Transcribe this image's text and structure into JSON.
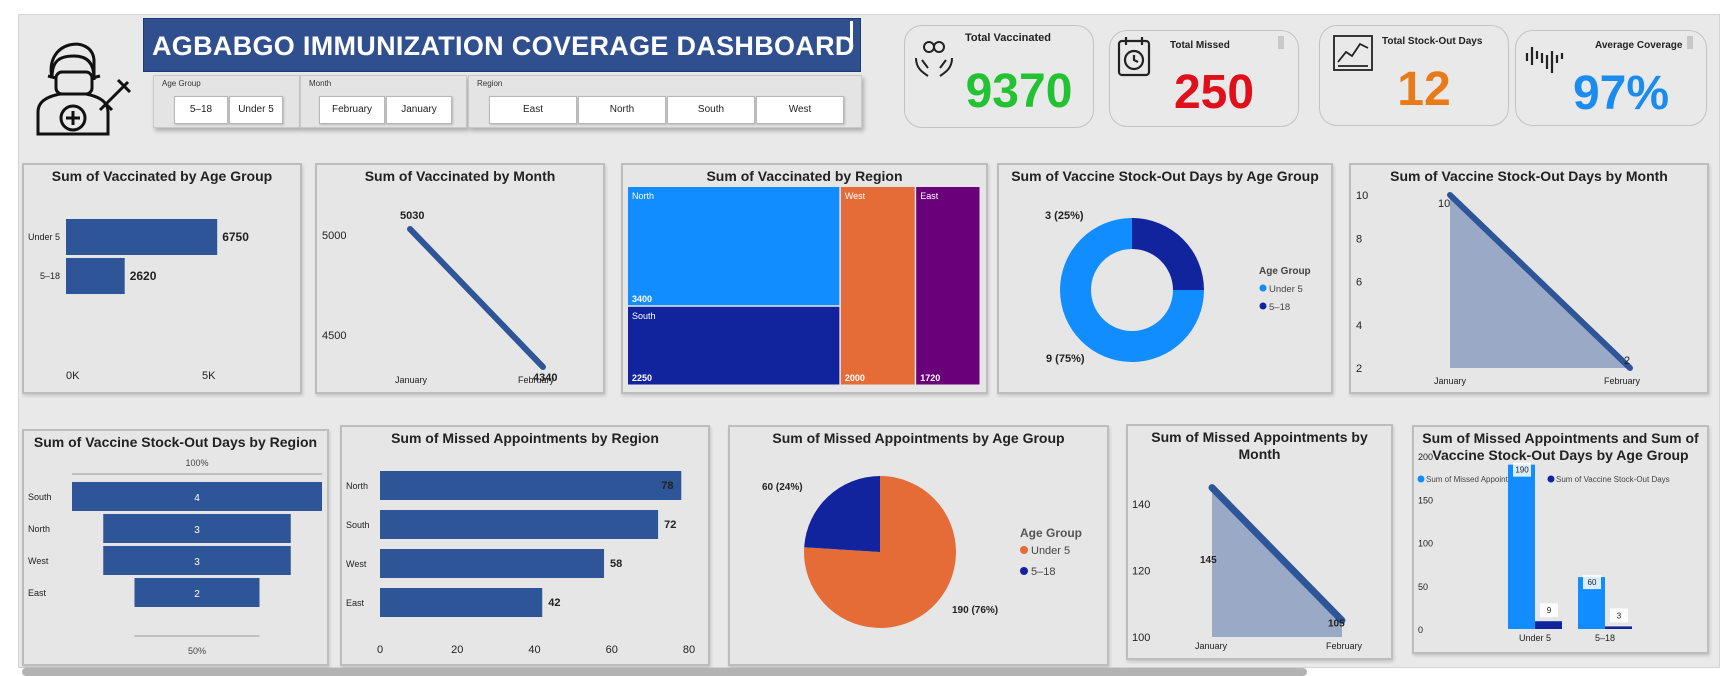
{
  "header": {
    "title": "AGBABGO IMMUNIZATION COVERAGE DASHBOARD"
  },
  "slicers": {
    "age_group": {
      "label": "Age Group",
      "options": [
        "5–18",
        "Under 5"
      ]
    },
    "month": {
      "label": "Month",
      "options": [
        "February",
        "January"
      ]
    },
    "region": {
      "label": "Region",
      "options": [
        "East",
        "North",
        "South",
        "West"
      ]
    }
  },
  "kpis": {
    "vaccinated": {
      "label": "Total Vaccinated",
      "value": "9370",
      "color": "#22c232"
    },
    "missed": {
      "label": "Total Missed",
      "value": "250",
      "color": "#e0101a"
    },
    "stockout": {
      "label": "Total Stock-Out Days",
      "value": "12",
      "color": "#e87a17"
    },
    "coverage": {
      "label": "Average Coverage",
      "value": "97%",
      "color": "#1a8cf0"
    }
  },
  "colors": {
    "bar": "#2e5597",
    "light_blue": "#118dff",
    "dark_blue": "#12239e",
    "orange": "#e66c37",
    "purple": "#6b007b",
    "area": "#9aa9c6"
  },
  "chart_data": [
    {
      "id": "vacc_age",
      "type": "bar",
      "title": "Sum of Vaccinated by Age Group",
      "categories": [
        "Under 5",
        "5–18"
      ],
      "values": [
        6750,
        2620
      ],
      "ticks": [
        "0K",
        "5K"
      ],
      "xlim": [
        0,
        7500
      ]
    },
    {
      "id": "vacc_month",
      "type": "line",
      "title": "Sum of Vaccinated by Month",
      "categories": [
        "January",
        "February"
      ],
      "values": [
        5030,
        4340
      ],
      "yticks": [
        "5000",
        "4500"
      ],
      "ylim": [
        4250,
        5200
      ]
    },
    {
      "id": "vacc_region",
      "type": "treemap",
      "title": "Sum of Vaccinated by Region",
      "categories": [
        "North",
        "South",
        "West",
        "East"
      ],
      "values": [
        3400,
        2250,
        2000,
        1720
      ]
    },
    {
      "id": "stock_age",
      "type": "donut",
      "title": "Sum of Vaccine Stock-Out Days by Age Group",
      "legend_title": "Age Group",
      "categories": [
        "Under 5",
        "5–18"
      ],
      "values": [
        9,
        3
      ],
      "labels": [
        "9 (75%)",
        "3 (25%)"
      ]
    },
    {
      "id": "stock_month",
      "type": "area",
      "title": "Sum of Vaccine Stock-Out Days by Month",
      "categories": [
        "January",
        "February"
      ],
      "values": [
        10,
        2
      ],
      "yticks": [
        "10",
        "8",
        "6",
        "4",
        "2"
      ],
      "ylim": [
        2,
        10
      ]
    },
    {
      "id": "stock_region",
      "type": "funnel",
      "title": "Sum of Vaccine Stock-Out Days by Region",
      "categories": [
        "South",
        "North",
        "West",
        "East"
      ],
      "values": [
        4,
        3,
        3,
        2
      ],
      "top_label": "100%",
      "bottom_label": "50%"
    },
    {
      "id": "missed_region",
      "type": "bar",
      "title": "Sum of Missed Appointments by Region",
      "categories": [
        "North",
        "South",
        "West",
        "East"
      ],
      "values": [
        78,
        72,
        58,
        42
      ],
      "ticks": [
        "0",
        "20",
        "40",
        "60",
        "80"
      ],
      "xlim": [
        0,
        80
      ]
    },
    {
      "id": "missed_age",
      "type": "pie",
      "title": "Sum of Missed Appointments by Age Group",
      "legend_title": "Age Group",
      "categories": [
        "Under 5",
        "5–18"
      ],
      "values": [
        190,
        60
      ],
      "labels": [
        "190 (76%)",
        "60 (24%)"
      ]
    },
    {
      "id": "missed_month",
      "type": "area",
      "title": "Sum of Missed Appointments by Month",
      "categories": [
        "January",
        "February"
      ],
      "values": [
        145,
        105
      ],
      "yticks": [
        "140",
        "120",
        "100"
      ],
      "ylim": [
        100,
        150
      ]
    },
    {
      "id": "missed_stock_age",
      "type": "bar",
      "title": "Sum of Missed Appointments and Sum of Vaccine Stock-Out Days by Age Group",
      "categories": [
        "Under 5",
        "5–18"
      ],
      "series": [
        {
          "name": "Sum of Missed Appointments",
          "values": [
            190,
            60
          ]
        },
        {
          "name": "Sum of Vaccine Stock-Out Days",
          "values": [
            9,
            3
          ]
        }
      ],
      "yticks": [
        "200",
        "150",
        "100",
        "50",
        "0"
      ],
      "ylim": [
        0,
        200
      ]
    }
  ]
}
